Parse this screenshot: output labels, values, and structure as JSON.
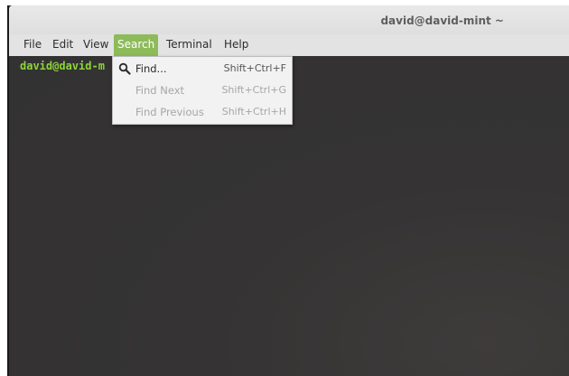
{
  "window": {
    "title": "david@david-mint ~"
  },
  "menubar": {
    "items": [
      {
        "label": "File"
      },
      {
        "label": "Edit"
      },
      {
        "label": "View"
      },
      {
        "label": "Search"
      },
      {
        "label": "Terminal"
      },
      {
        "label": "Help"
      }
    ],
    "active": "Search"
  },
  "terminal": {
    "prompt": "david@david-m"
  },
  "search_menu": {
    "items": [
      {
        "label": "Find...",
        "shortcut": "Shift+Ctrl+F",
        "enabled": true,
        "icon": "search-icon"
      },
      {
        "label": "Find Next",
        "shortcut": "Shift+Ctrl+G",
        "enabled": false
      },
      {
        "label": "Find Previous",
        "shortcut": "Shift+Ctrl+H",
        "enabled": false
      }
    ]
  },
  "colors": {
    "terminal_bg": "#333232",
    "prompt": "#8cd43a",
    "active_menu": "#8dbb5a"
  }
}
